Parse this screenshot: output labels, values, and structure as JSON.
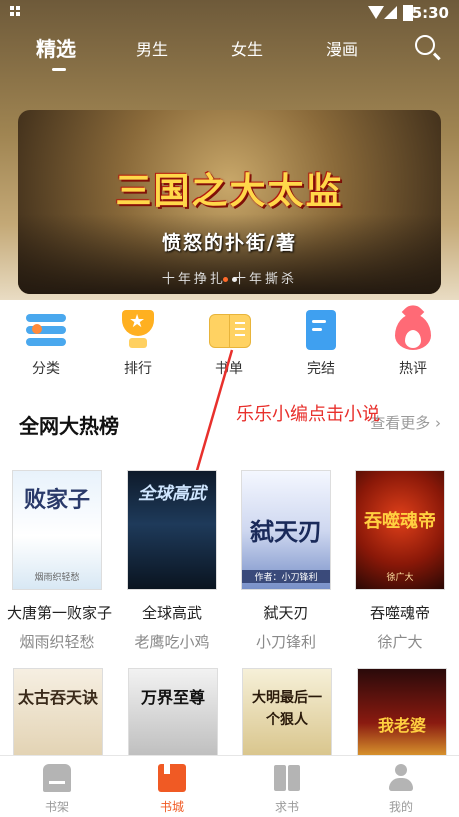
{
  "status_bar": {
    "time": "5:30"
  },
  "nav": {
    "tabs": [
      "精选",
      "男生",
      "女生",
      "漫画"
    ],
    "active_tab": "精选"
  },
  "banner": {
    "title": "三国之大太监",
    "author_line": "愤怒的扑街/著",
    "tagline": "十年挣扎 十年撕杀"
  },
  "categories": [
    "分类",
    "排行",
    "书单",
    "完结",
    "热评"
  ],
  "section": {
    "title": "全网大热榜",
    "more": "查看更多"
  },
  "annotation": "乐乐小编点击小说",
  "books": [
    {
      "name": "大唐第一败家子",
      "author": "烟雨织轻愁",
      "cover_text": "败家子",
      "cover_sub": "烟雨织轻愁"
    },
    {
      "name": "全球高武",
      "author": "老鹰吃小鸡",
      "cover_text": "全球高武",
      "cover_sub": ""
    },
    {
      "name": "弑天刃",
      "author": "小刀锋利",
      "cover_text": "弑天刃",
      "cover_sub": "作者：小刀锋利"
    },
    {
      "name": "吞噬魂帝",
      "author": "徐广大",
      "cover_text": "吞噬魂帝",
      "cover_sub": "徐广大"
    }
  ],
  "books_row2": [
    {
      "cover_text": "太古吞天诀"
    },
    {
      "cover_text": "万界至尊"
    },
    {
      "cover_text": "大明最后一个狠人"
    },
    {
      "cover_text": "我老婆"
    }
  ],
  "bottom_tabs": [
    "书架",
    "书城",
    "求书",
    "我的"
  ],
  "active_bottom_tab": "书城",
  "colors": {
    "accent": "#f05a24",
    "annotation": "#e8302c",
    "header": "#a08552"
  }
}
